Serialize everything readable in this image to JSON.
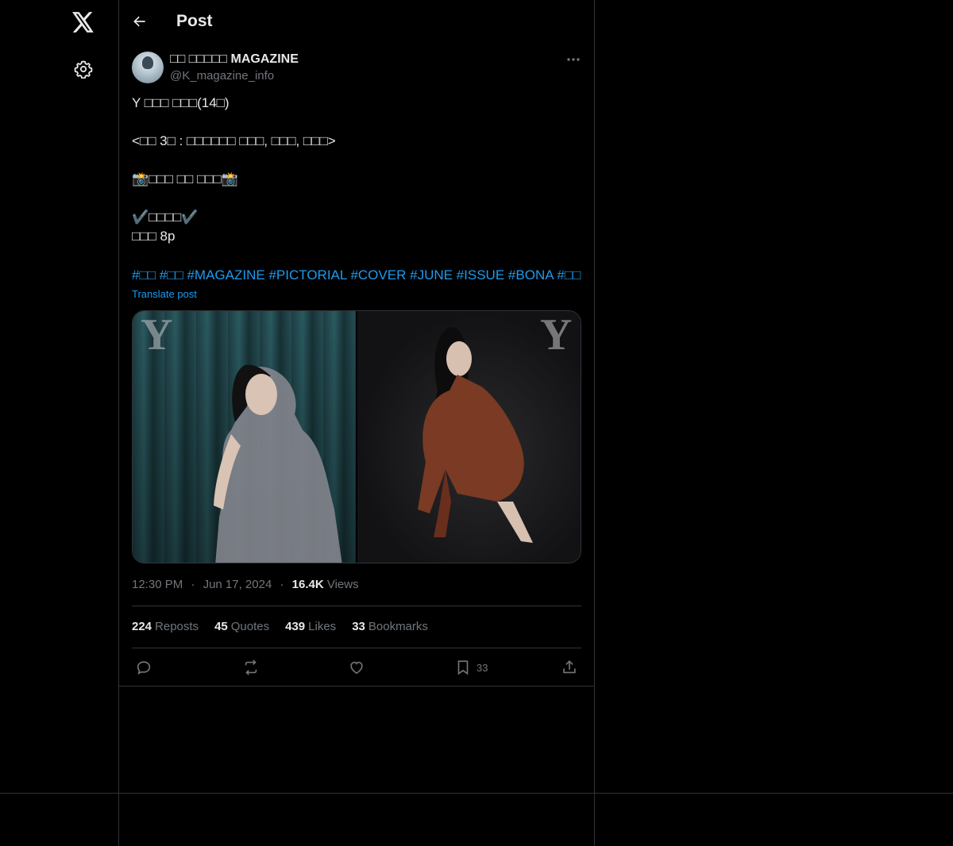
{
  "nav": {
    "logo_icon": "x-logo-icon",
    "settings_icon": "gear-icon"
  },
  "header": {
    "back_icon": "arrow-left-icon",
    "title": "Post"
  },
  "post": {
    "author": {
      "name": "□□ □□□□□ MAGAZINE",
      "handle": "@K_magazine_info",
      "avatar_icon": "avatar"
    },
    "more_icon": "more-horizontal-icon",
    "lines": [
      "Y □□□ □□□(14□)",
      "",
      "<□□ 3□ : □□□□□□ □□□, □□□, □□□>",
      "",
      "📸□□□ □□ □□□📸",
      "",
      "✔️□□□□✔️",
      "□□□ 8p"
    ],
    "hashtags": [
      "#□□",
      "#□□",
      "#MAGAZINE",
      "#PICTORIAL",
      "#COVER",
      "#JUNE",
      "#ISSUE",
      "#BONA",
      "#□□"
    ],
    "translate_label": "Translate post",
    "media": {
      "photo_1_logo": "Y",
      "photo_2_logo": "Y"
    },
    "time": "12:30 PM",
    "separator": "·",
    "date": "Jun 17, 2024",
    "views_count": "16.4K",
    "views_label": "Views",
    "stats": [
      {
        "count": "224",
        "label": "Reposts"
      },
      {
        "count": "45",
        "label": "Quotes"
      },
      {
        "count": "439",
        "label": "Likes"
      },
      {
        "count": "33",
        "label": "Bookmarks"
      }
    ],
    "actions": {
      "reply_icon": "reply-icon",
      "repost_icon": "repost-icon",
      "like_icon": "heart-icon",
      "bookmark_icon": "bookmark-icon",
      "bookmark_count": "33",
      "share_icon": "share-icon"
    }
  },
  "colors": {
    "background": "#000000",
    "text": "#e7e9ea",
    "secondary": "#71767b",
    "accent": "#1d9bf0",
    "border": "#2f3336"
  }
}
